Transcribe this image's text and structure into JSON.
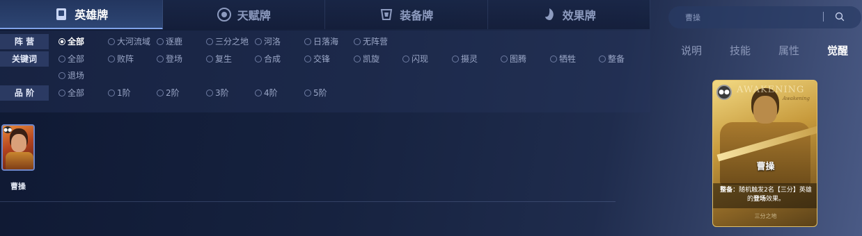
{
  "tabs": [
    {
      "label": "英雄牌",
      "icon": "hero-card-icon",
      "active": true
    },
    {
      "label": "天赋牌",
      "icon": "talent-card-icon",
      "active": false
    },
    {
      "label": "装备牌",
      "icon": "equipment-card-icon",
      "active": false
    },
    {
      "label": "效果牌",
      "icon": "effect-card-icon",
      "active": false
    }
  ],
  "filters": {
    "camp": {
      "label": "阵  营",
      "options": [
        "全部",
        "大河流域",
        "逐鹿",
        "三分之地",
        "河洛",
        "日落海",
        "无阵营"
      ],
      "selected": "全部"
    },
    "keyword": {
      "label": "关键词",
      "options": [
        "全部",
        "败阵",
        "登场",
        "复生",
        "合成",
        "交锋",
        "凯旋",
        "闪现",
        "摄灵",
        "图腾",
        "牺牲",
        "整备",
        "退场"
      ]
    },
    "tier": {
      "label": "品  阶",
      "options": [
        "全部",
        "1阶",
        "2阶",
        "3阶",
        "4阶",
        "5阶"
      ]
    }
  },
  "results": [
    {
      "name": "曹操"
    }
  ],
  "search": {
    "placeholder": "曹操"
  },
  "detail_tabs": [
    {
      "label": "说明",
      "active": false
    },
    {
      "label": "技能",
      "active": false
    },
    {
      "label": "属性",
      "active": false
    },
    {
      "label": "觉醒",
      "active": true
    }
  ],
  "card": {
    "awaken_title": "AWAKENING",
    "awaken_sub": "Awakening",
    "name": "曹操",
    "desc_keyword": "整备",
    "desc_text": "：随机触发2名【三分】英雄的",
    "desc_keyword2": "登场",
    "desc_end": "效果。",
    "foot": "三分之地"
  },
  "colors": {
    "accent": "#7fa2e8",
    "card_gold": "#c79a3c"
  }
}
